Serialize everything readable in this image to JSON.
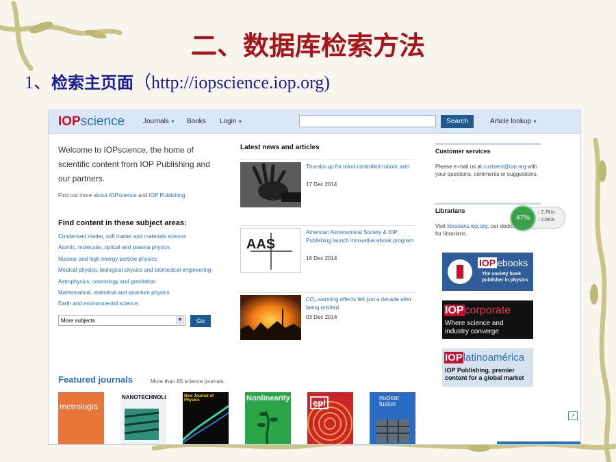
{
  "slide": {
    "title": "二、数据库检索方法",
    "subtitle_num": "1、",
    "subtitle_cn": "检索主页面",
    "subtitle_url": "（http://iopscience.iop.org)"
  },
  "site": {
    "logo_a": "IOP",
    "logo_b": "science",
    "nav": {
      "journals": "Journals",
      "books": "Books",
      "login": "Login",
      "lookup": "Article lookup"
    },
    "search_button": "Search",
    "search_value": ""
  },
  "welcome": {
    "lines": [
      "Welcome to IOPscience, the home of",
      "scientific content from IOP Publishing and",
      "our partners."
    ],
    "findout_pre": "Find out more",
    "findout_l1": "about IOPscience",
    "findout_mid": "and",
    "findout_l2": "IOP Publishing."
  },
  "subjects": {
    "heading": "Find content in these subject areas:",
    "items": [
      "Condensed matter, soft matter and materials science",
      "Atomic, molecular, optical and plasma physics",
      "Nuclear and high energy particle physics",
      "Medical physics, biological physics and biomedical engineering",
      "Astrophysics, cosmology and gravitation",
      "Mathematical, statistical and quantum physics",
      "Earth and environmental science"
    ],
    "select_value": "More subjects",
    "go_button": "Go"
  },
  "news": {
    "heading": "Latest news and articles",
    "items": [
      {
        "title": "Thumbs-up for mind-controlled robotic arm",
        "date": "17 Dec 2014"
      },
      {
        "title": "American Astronomical Society & IOP Publishing launch innovative ebook program",
        "date": "16 Dec 2014"
      },
      {
        "title": "CO₂ warming effects felt just a decade after being emitted",
        "date": "03 Dec 2014"
      }
    ],
    "aas_logo": "AAS"
  },
  "right": {
    "cs_heading": "Customer services",
    "cs_text1": "Please e-mail us at",
    "cs_email": "custserv@iop.org",
    "cs_text2": "with your questions, comments or suggestions.",
    "lib_heading": "Librarians",
    "lib_text1": "Visit",
    "lib_link": "librarians.iop.org,",
    "lib_text2": "our dedicated home for librarians."
  },
  "banners": {
    "ebooks": {
      "brand": "IOP",
      "name": "ebooks",
      "tagline1": "The society book",
      "tagline2": "publisher in physics"
    },
    "corporate": {
      "brand": "IOP",
      "name": "corporate",
      "tagline1": "Where science and",
      "tagline2": "industry converge"
    },
    "latino": {
      "brand": "IOP",
      "name": "latinoamérica",
      "tagline1": "IOP Publishing, premier",
      "tagline2": "content for a global market"
    }
  },
  "featured": {
    "heading": "Featured journals",
    "sub": "More than 65 science journals.",
    "covers": [
      "metrologia",
      "NANOTECHNOLOGY",
      "New Journal of Physics",
      "Nonlinearity",
      "epl",
      "nuclear fusion"
    ]
  },
  "speed": {
    "percent": "47%",
    "up": "2.7K/s",
    "down": "2.5K/s"
  },
  "colors": {
    "title_red": "#a8141c",
    "subtitle_blue": "#1b1b9a",
    "iop_blue": "#2a6ebb",
    "iop_red": "#c8102e",
    "button_navy": "#1e5b92"
  }
}
